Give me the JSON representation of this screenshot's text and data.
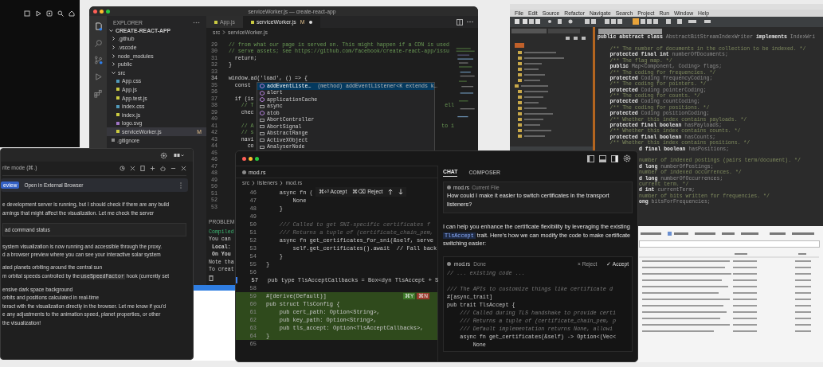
{
  "vscode": {
    "title": "serviceWorker.js — create-react-app",
    "explorer_title": "EXPLORER",
    "project": "CREATE-REACT-APP",
    "tree": [
      {
        "label": ".github",
        "kind": "folder",
        "expanded": false,
        "selected": false
      },
      {
        "label": ".vscode",
        "kind": "folder",
        "expanded": false,
        "selected": false
      },
      {
        "label": "node_modules",
        "kind": "folder",
        "expanded": false,
        "selected": false
      },
      {
        "label": "public",
        "kind": "folder",
        "expanded": false,
        "selected": false
      },
      {
        "label": "src",
        "kind": "folder",
        "expanded": true,
        "selected": false,
        "children": [
          {
            "label": "App.css",
            "kind": "css",
            "selected": false
          },
          {
            "label": "App.js",
            "kind": "js",
            "selected": false
          },
          {
            "label": "App.test.js",
            "kind": "js",
            "selected": false
          },
          {
            "label": "index.css",
            "kind": "css",
            "selected": false
          },
          {
            "label": "index.js",
            "kind": "js",
            "selected": false
          },
          {
            "label": "logo.svg",
            "kind": "svg",
            "selected": false
          },
          {
            "label": "serviceWorker.js",
            "kind": "js",
            "selected": true,
            "badge": "M"
          }
        ]
      },
      {
        "label": ".gitignore",
        "kind": "file",
        "selected": false
      }
    ],
    "tabs": [
      {
        "label": "App.js",
        "selected": false,
        "unsaved": false
      },
      {
        "label": "serviceWorker.js",
        "badge": "M",
        "selected": true,
        "unsaved": true
      }
    ],
    "breadcrumb": [
      "src",
      "serviceWorker.js"
    ],
    "lines": [
      {
        "n": "29",
        "text": "  // from what our page is served on. This might happen if a CDN is used",
        "kind": "comment",
        "current": false
      },
      {
        "n": "30",
        "text": "  // serve assets; see https://github.com/facebook/create-react-app/issu",
        "kind": "comment",
        "current": false
      },
      {
        "n": "31",
        "text": "    return;",
        "kind": "code",
        "current": false
      },
      {
        "n": "32",
        "text": "  }",
        "kind": "code",
        "current": false
      },
      {
        "n": "33",
        "current": false
      },
      {
        "n": "34",
        "text": "  window.ad('load', () => {",
        "kind": "code",
        "current": true
      },
      {
        "n": "35",
        "text": "    const",
        "kind": "code",
        "current": false
      },
      {
        "n": "36",
        "current": false
      },
      {
        "n": "37",
        "text": "    if (is",
        "kind": "code",
        "current": false
      },
      {
        "n": "38",
        "text": "      // T",
        "kind": "comment",
        "current": false,
        "tail": "ell"
      },
      {
        "n": "39",
        "text": "      chec",
        "kind": "code",
        "current": false
      },
      {
        "n": "40",
        "current": false
      },
      {
        "n": "41",
        "text": "      // A",
        "kind": "comment",
        "current": false,
        "tail": "to i"
      },
      {
        "n": "42",
        "text": "      // s",
        "kind": "comment",
        "current": false
      },
      {
        "n": "43",
        "text": "      navi",
        "kind": "code",
        "current": false
      },
      {
        "n": "44",
        "text": "        co",
        "kind": "code",
        "current": false
      },
      {
        "n": "45",
        "current": false
      },
      {
        "n": "46",
        "current": false
      },
      {
        "n": "47",
        "current": false
      },
      {
        "n": "48",
        "current": false
      },
      {
        "n": "49",
        "current": false
      },
      {
        "n": "50",
        "current": false
      },
      {
        "n": "51",
        "current": false
      },
      {
        "n": "52",
        "current": false
      },
      {
        "n": "53",
        "current": false
      }
    ],
    "autocomplete": [
      {
        "label": "addEventListe…",
        "detail": "(method) addEventListener<K extends k…",
        "kind": "method",
        "selected": true
      },
      {
        "label": "alert",
        "kind": "method",
        "selected": false
      },
      {
        "label": "applicationCache",
        "kind": "method",
        "selected": false
      },
      {
        "label": "async",
        "kind": "word",
        "selected": false
      },
      {
        "label": "atob",
        "kind": "method",
        "selected": false
      },
      {
        "label": "AbortController",
        "kind": "word",
        "selected": false
      },
      {
        "label": "AbortSignal",
        "kind": "word",
        "selected": false
      },
      {
        "label": "AbstractRange",
        "kind": "word",
        "selected": false
      },
      {
        "label": "ActiveXObject",
        "kind": "word",
        "selected": false
      },
      {
        "label": "AnalyserNode",
        "kind": "word",
        "selected": false
      }
    ],
    "panel": {
      "tab": "PROBLEM",
      "lines": [
        {
          "text": "Compiled",
          "kind": "success"
        },
        {
          "text": "You can",
          "kind": "plain"
        },
        {
          "text": "Local:",
          "kind": "bold"
        },
        {
          "text": "On You",
          "kind": "bold"
        },
        {
          "text": "Note tha",
          "kind": "plain"
        },
        {
          "text": "To creat",
          "kind": "plain"
        }
      ]
    }
  },
  "eclipse": {
    "menu": [
      "File",
      "Edit",
      "Source",
      "Refactor",
      "Navigate",
      "Search",
      "Project",
      "Run",
      "Window",
      "Help"
    ],
    "lines": [
      {
        "kind": "full",
        "parts": [
          {
            "text": "public abstract class",
            "kind": "keyword"
          },
          {
            "text": " AbstractBitStreamIndexWriter ",
            "kind": "name"
          },
          {
            "text": "implements",
            "kind": "keyword"
          },
          {
            "text": " IndexWri",
            "kind": "name"
          }
        ]
      },
      {
        "kind": "blank"
      },
      {
        "kind": "full",
        "parts": [
          {
            "text": "    /** The number of documents in the collection to be indexed. */",
            "kind": "comment"
          }
        ]
      },
      {
        "kind": "full",
        "parts": [
          {
            "text": "    protected final int",
            "kind": "keyword"
          },
          {
            "text": " numberOfDocuments;",
            "kind": "name"
          }
        ]
      },
      {
        "kind": "full",
        "parts": [
          {
            "text": "    /** The flag map. */",
            "kind": "comment"
          }
        ]
      },
      {
        "kind": "full",
        "parts": [
          {
            "text": "    public",
            "kind": "keyword"
          },
          {
            "text": " Map<Component, Coding> flags;",
            "kind": "name"
          }
        ]
      },
      {
        "kind": "full",
        "parts": [
          {
            "text": "    /** The coding for frequencies. */",
            "kind": "comment"
          }
        ]
      },
      {
        "kind": "full",
        "parts": [
          {
            "text": "    protected",
            "kind": "keyword"
          },
          {
            "text": " Coding frequencyCoding;",
            "kind": "name"
          }
        ]
      },
      {
        "kind": "full",
        "parts": [
          {
            "text": "    /** The coding for pointers. */",
            "kind": "comment"
          }
        ]
      },
      {
        "kind": "full",
        "parts": [
          {
            "text": "    protected",
            "kind": "keyword"
          },
          {
            "text": " Coding pointerCoding;",
            "kind": "name"
          }
        ]
      },
      {
        "kind": "full",
        "parts": [
          {
            "text": "    /** The coding for counts. */",
            "kind": "comment"
          }
        ]
      },
      {
        "kind": "full",
        "parts": [
          {
            "text": "    protected",
            "kind": "keyword"
          },
          {
            "text": " Coding countCoding;",
            "kind": "name"
          }
        ]
      },
      {
        "kind": "full",
        "parts": [
          {
            "text": "    /** The coding for positions. */",
            "kind": "comment"
          }
        ]
      },
      {
        "kind": "full",
        "parts": [
          {
            "text": "    protected",
            "kind": "keyword"
          },
          {
            "text": " Coding positionCoding;",
            "kind": "name"
          }
        ]
      },
      {
        "kind": "full",
        "parts": [
          {
            "text": "    /** Whether this index contains payloads. */",
            "kind": "comment"
          }
        ]
      },
      {
        "kind": "full",
        "parts": [
          {
            "text": "    protected final boolean",
            "kind": "keyword"
          },
          {
            "text": " hasPayloads;",
            "kind": "name"
          }
        ]
      },
      {
        "kind": "full",
        "parts": [
          {
            "text": "    /** Whether this index contains counts. */",
            "kind": "comment"
          }
        ]
      },
      {
        "kind": "full",
        "parts": [
          {
            "text": "    protected final boolean",
            "kind": "keyword"
          },
          {
            "text": " hasCounts;",
            "kind": "name"
          }
        ]
      },
      {
        "kind": "full",
        "parts": [
          {
            "text": "    /** Whether this index contains positions. */",
            "kind": "comment"
          }
        ]
      },
      {
        "kind": "tail",
        "parts": [
          {
            "text": "d final boolean",
            "kind": "keyword"
          },
          {
            "text": " hasPositions;",
            "kind": "name"
          }
        ]
      },
      {
        "kind": "blank"
      },
      {
        "kind": "tail",
        "parts": [
          {
            "text": "number of indexed postings (pairs term/document). */",
            "kind": "comment"
          }
        ]
      },
      {
        "kind": "tail",
        "parts": [
          {
            "text": "d long",
            "kind": "keyword"
          },
          {
            "text": " numberOfPostings;",
            "kind": "name"
          }
        ]
      },
      {
        "kind": "tail",
        "parts": [
          {
            "text": "number of indexed occurrences. */",
            "kind": "comment"
          }
        ]
      },
      {
        "kind": "tail",
        "parts": [
          {
            "text": "d long",
            "kind": "keyword"
          },
          {
            "text": " numberOfOccurrences;",
            "kind": "name"
          }
        ]
      },
      {
        "kind": "tail",
        "parts": [
          {
            "text": "current term. */",
            "kind": "comment"
          }
        ]
      },
      {
        "kind": "tail",
        "parts": [
          {
            "text": "d int",
            "kind": "keyword"
          },
          {
            "text": " currentTerm;",
            "kind": "name"
          }
        ]
      },
      {
        "kind": "tail",
        "parts": [
          {
            "text": "number of bits written for frequencies. */",
            "kind": "comment"
          }
        ]
      },
      {
        "kind": "tail",
        "parts": [
          {
            "text": "ong",
            "kind": "keyword"
          },
          {
            "text": " bitsForFrequencies;",
            "kind": "name"
          }
        ]
      }
    ]
  },
  "windsurf": {
    "mode": "rite mode (⌘.)",
    "preview": {
      "label": "eview",
      "selected": true
    },
    "external": "Open in External Browser",
    "blocks": [
      {
        "kind": "text",
        "lines": [
          {
            "text": "e development server is running, but I should check if there are any build"
          },
          {
            "text": "arnings that might affect the visualization. Let me check the server"
          }
        ]
      },
      {
        "kind": "status",
        "lines": [
          {
            "text": "ad command status"
          }
        ]
      },
      {
        "kind": "text",
        "lines": [
          {
            "text": "system visualization is now running and accessible through the proxy."
          },
          {
            "text": "d a browser preview where you can see your interactive solar system"
          }
        ]
      },
      {
        "kind": "text",
        "lines": [
          {
            "text": "ated planets orbiting around the central sun"
          },
          {
            "text": "m orbital speeds controlled by the",
            "code": "useSpeedFactor",
            "after": "hook (currently set"
          }
        ]
      },
      {
        "kind": "text",
        "lines": [
          {
            "text": "ensive dark space background"
          },
          {
            "text": "orbits and positions calculated in real-time"
          },
          {
            "text": "teract with the visualization directly in the browser. Let me know if you'd"
          },
          {
            "text": "e any adjustments to the animation speed, planet properties, or other"
          },
          {
            "text": "the visualization!"
          }
        ]
      }
    ]
  },
  "cursor": {
    "tabs": [
      {
        "label": "mod.rs",
        "selected": true
      }
    ],
    "breadcrumb": [
      "src",
      "listeners",
      "mod.rs"
    ],
    "inline_actions": [
      {
        "keys": "⌘⏎",
        "label": "Accept"
      },
      {
        "keys": "⌘⌫",
        "label": "Reject"
      }
    ],
    "lines": [
      {
        "n": "46",
        "text": "    async fn (",
        "kind": "code",
        "added": false,
        "current": false
      },
      {
        "n": "47",
        "text": "        None",
        "kind": "code",
        "added": false,
        "current": false
      },
      {
        "n": "48",
        "text": "    }",
        "kind": "code",
        "added": false,
        "current": false
      },
      {
        "n": "49",
        "added": false,
        "current": false
      },
      {
        "n": "50",
        "text": "    /// Called to get SNI-specific certificates f",
        "kind": "comment",
        "added": false,
        "current": false
      },
      {
        "n": "51",
        "text": "    /// Returns a tuple of (certificate_chain_pem,",
        "kind": "comment",
        "added": false,
        "current": false
      },
      {
        "n": "52",
        "text": "    async fn get_certificates_for_sni(&self, serve",
        "kind": "code",
        "added": false,
        "current": false
      },
      {
        "n": "53",
        "text": "        self.get_certificates().await  // Fall back",
        "kind": "code",
        "added": false,
        "current": false
      },
      {
        "n": "54",
        "text": "    }",
        "kind": "code",
        "added": false,
        "current": false
      },
      {
        "n": "55",
        "text": "}",
        "kind": "code",
        "added": false,
        "current": false
      },
      {
        "n": "56",
        "added": false,
        "current": false
      },
      {
        "n": "57",
        "text": "pub type TlsAcceptCallbacks = Box<dyn TlsAccept + S",
        "kind": "code",
        "added": false,
        "current": true
      },
      {
        "n": "58",
        "added": false,
        "current": false
      },
      {
        "n": "59",
        "text": "#[derive(Default)]",
        "kind": "code",
        "added": true,
        "current": false,
        "badges": [
          {
            "text": "⌘Y",
            "kind": "accept"
          },
          {
            "text": "⌘N",
            "kind": "reject"
          }
        ]
      },
      {
        "n": "60",
        "text": "pub struct TlsConfig {",
        "kind": "code",
        "added": true,
        "current": false
      },
      {
        "n": "61",
        "text": "    pub cert_path: Option<String>,",
        "kind": "code",
        "added": true,
        "current": false
      },
      {
        "n": "62",
        "text": "    pub key_path: Option<String>,",
        "kind": "code",
        "added": true,
        "current": false
      },
      {
        "n": "63",
        "text": "    pub tls_accept: Option<TlsAcceptCallbacks>,",
        "kind": "code",
        "added": true,
        "current": false
      },
      {
        "n": "64",
        "text": "}",
        "kind": "code",
        "added": true,
        "current": false
      },
      {
        "n": "65",
        "added": false,
        "current": false
      }
    ],
    "chat": {
      "tabs": [
        {
          "label": "CHAT",
          "selected": true
        },
        {
          "label": "COMPOSER",
          "selected": false
        }
      ],
      "context": {
        "file": "mod.rs",
        "note": "Current File"
      },
      "question": "How could I make it easier to switch certificates in the transport listeners?",
      "answer": {
        "before": "I can help you enhance the certificate flexibility by leveraging the existing",
        "code": "TlsAccept",
        "after": "trait. Here's how we can modify the code to make certificate switching easier:"
      },
      "block": {
        "file": "mod.rs",
        "status": "Done",
        "reject": "× Reject",
        "accept": "✓ Accept",
        "lines": [
          {
            "text": "// ... existing code ...",
            "kind": "comment"
          },
          {
            "kind": "blank"
          },
          {
            "text": "/// The APIs to customize things like certificate d",
            "kind": "comment"
          },
          {
            "text": "#[async_trait]",
            "kind": "code"
          },
          {
            "text": "pub trait TlsAccept {",
            "kind": "code"
          },
          {
            "text": "    /// Called during TLS handshake to provide certi",
            "kind": "comment"
          },
          {
            "text": "    /// Returns a tuple of (certificate_chain_pem, p",
            "kind": "comment"
          },
          {
            "text": "    /// Default implementation returns None, allowi",
            "kind": "comment"
          },
          {
            "text": "    async fn get_certificates(&self) -> Option<(Vec<",
            "kind": "code"
          },
          {
            "text": "        None",
            "kind": "code"
          }
        ]
      }
    }
  }
}
